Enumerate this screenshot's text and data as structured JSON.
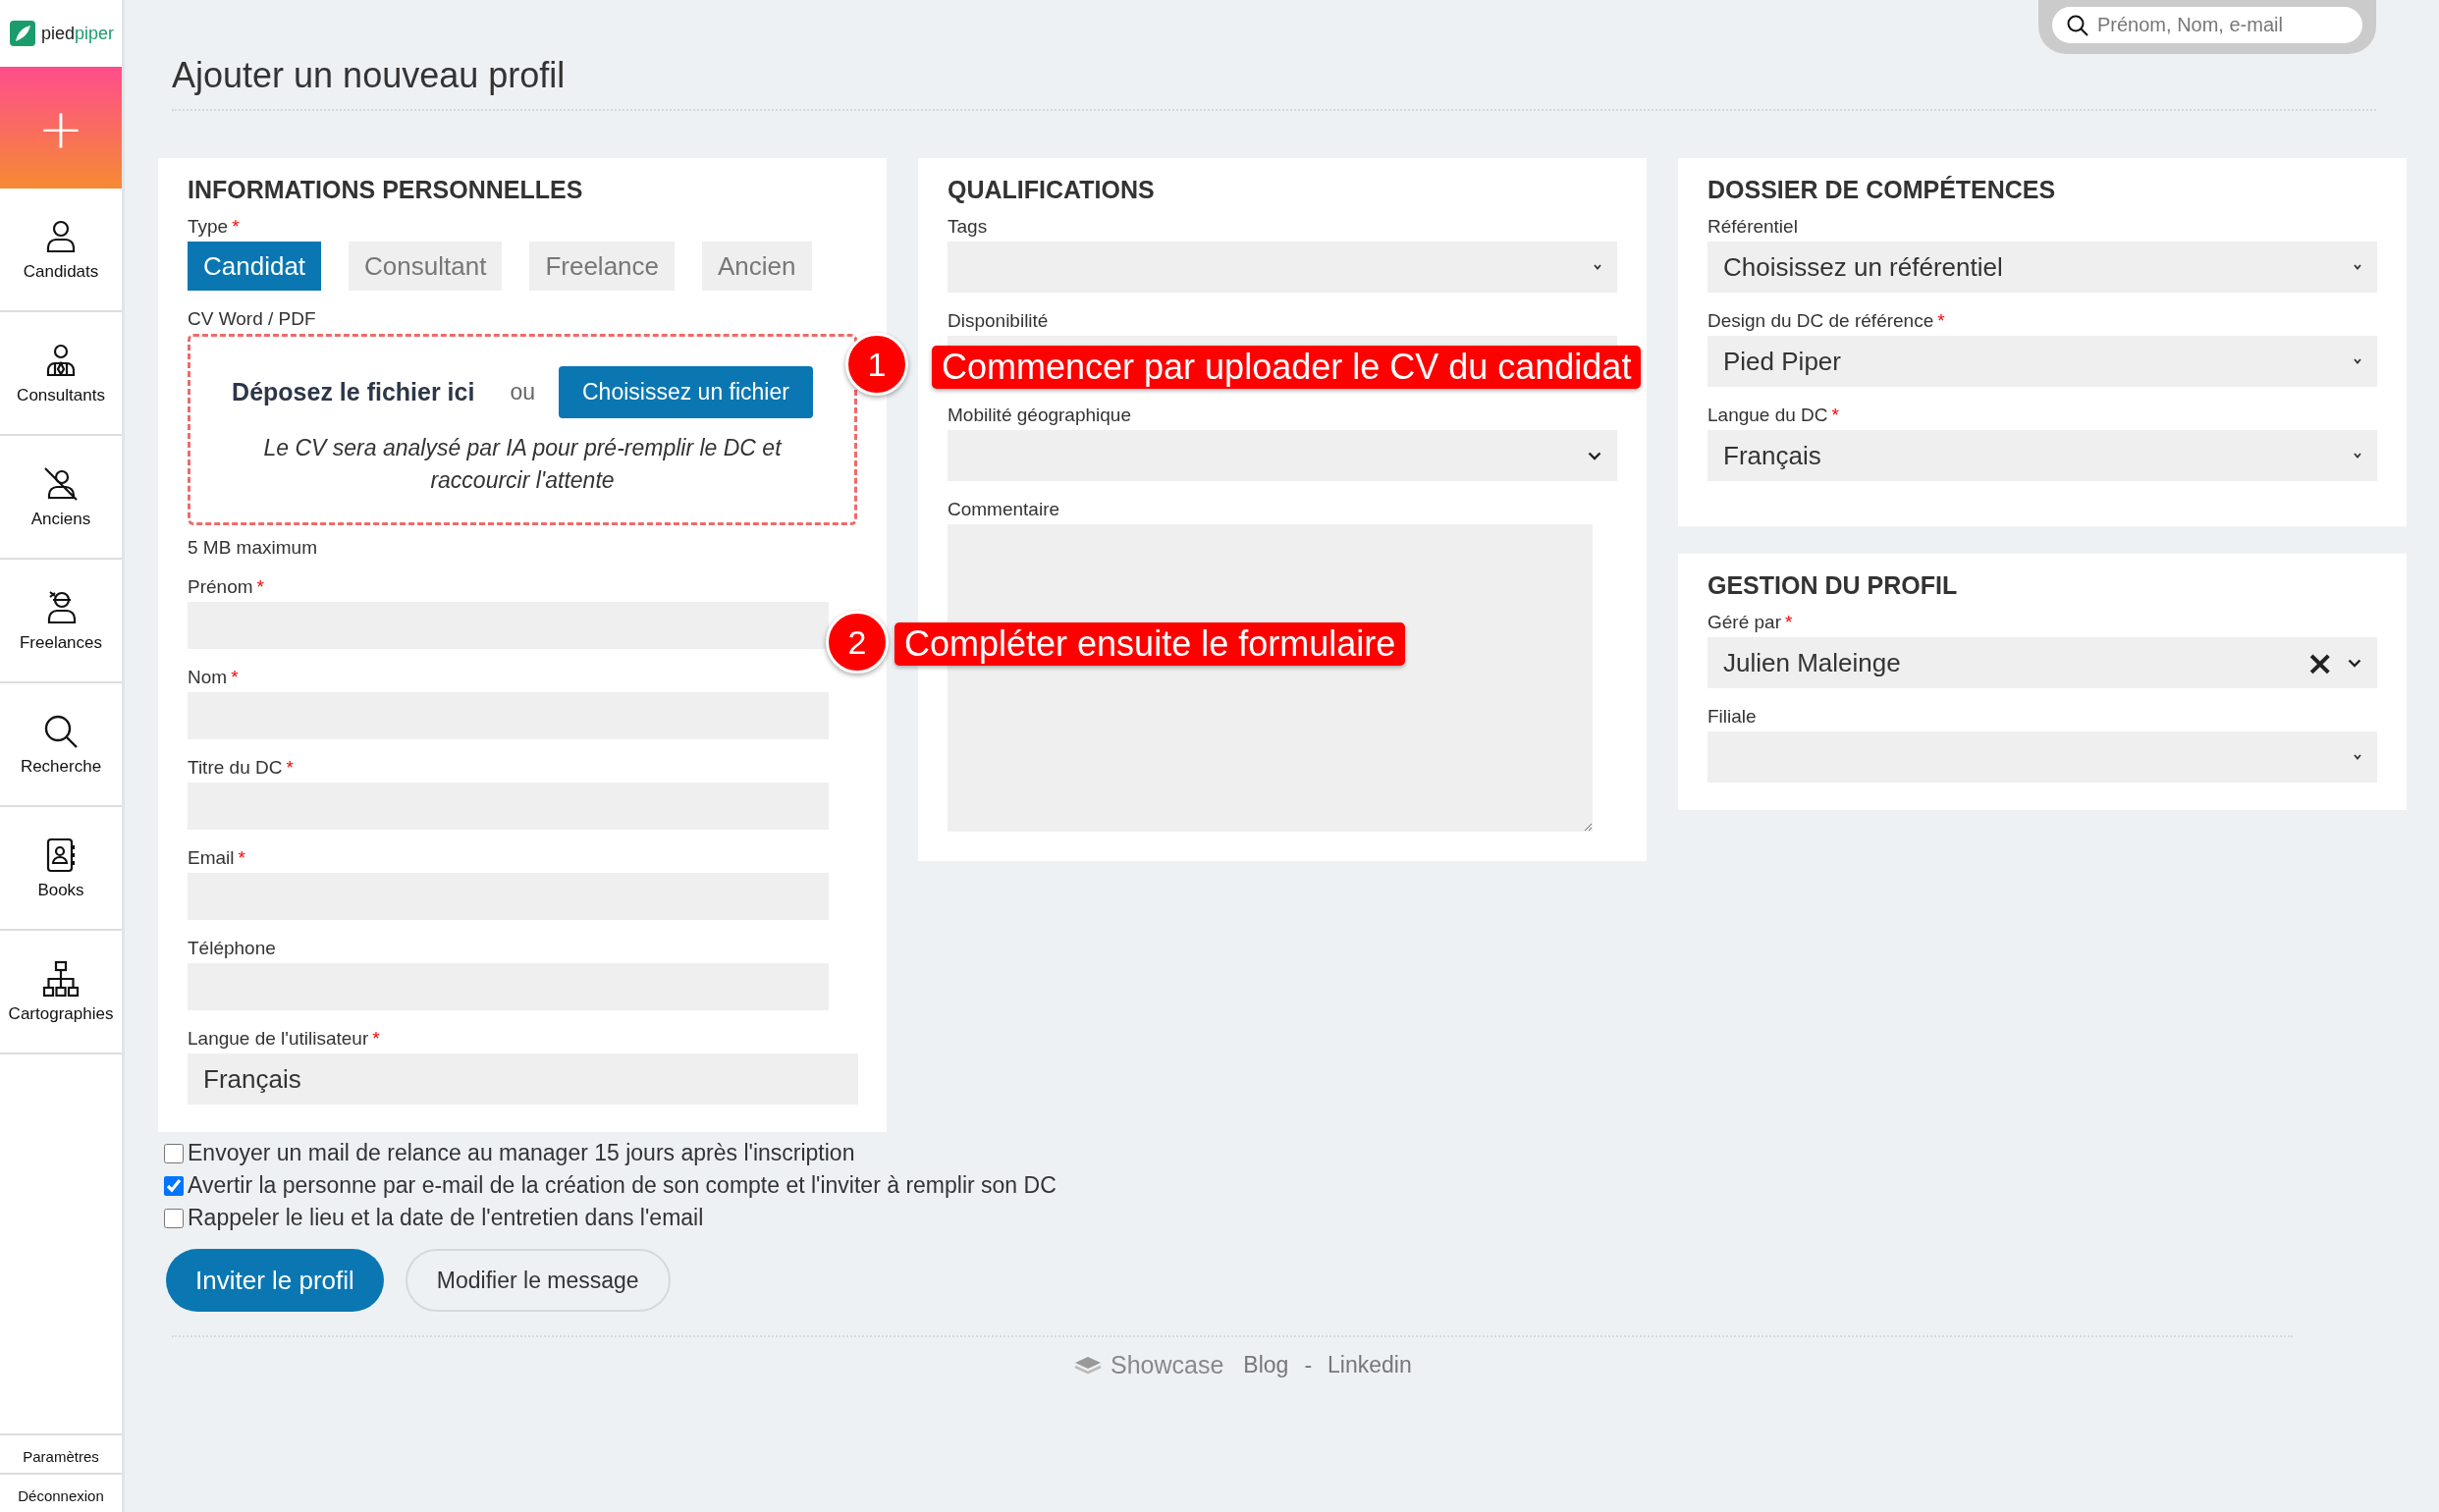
{
  "brand": {
    "part_1": "pied",
    "part_2": "piper"
  },
  "sidebar": {
    "add_button": "+",
    "items": [
      {
        "label": "Candidats",
        "kind": "person"
      },
      {
        "label": "Consultants",
        "kind": "consultant"
      },
      {
        "label": "Anciens",
        "kind": "former"
      },
      {
        "label": "Freelances",
        "kind": "freelance"
      },
      {
        "label": "Recherche",
        "kind": "search"
      },
      {
        "label": "Books",
        "kind": "book"
      },
      {
        "label": "Cartographies",
        "kind": "org"
      }
    ],
    "bottom_links": [
      "Paramètres",
      "Déconnexion"
    ]
  },
  "search": {
    "placeholder": "Prénom, Nom, e-mail"
  },
  "page_title": "Ajouter un nouveau profil",
  "columns": [
    [
      {
        "title": "INFORMATIONS PERSONNELLES",
        "fields": [
          {
            "kind": "tabs",
            "label": "Type",
            "required_mark": "*",
            "tabs": [
              {
                "label": "Candidat",
                "selected": true
              },
              {
                "label": "Consultant",
                "selected": false
              },
              {
                "label": "Freelance",
                "selected": false
              },
              {
                "label": "Ancien",
                "selected": false
              }
            ]
          },
          {
            "kind": "dropzone",
            "label": "CV Word / PDF",
            "drop_text": "Déposez le fichier ici",
            "or_text": "ou",
            "button": "Choisissez un fichier",
            "hint": "Le CV sera analysé par IA pour pré-remplir le DC et raccourcir l'attente"
          },
          {
            "kind": "note",
            "text": "5 MB maximum"
          },
          {
            "kind": "input",
            "label": "Prénom",
            "required_mark": "*"
          },
          {
            "kind": "input",
            "label": "Nom",
            "required_mark": "*"
          },
          {
            "kind": "input",
            "label": "Titre du DC",
            "required_mark": "*"
          },
          {
            "kind": "input",
            "label": "Email",
            "required_mark": "*"
          },
          {
            "kind": "input",
            "label": "Téléphone"
          },
          {
            "kind": "value_field",
            "label": "Langue de l'utilisateur",
            "required_mark": "*",
            "value": "Français"
          }
        ]
      }
    ],
    [
      {
        "title": "QUALIFICATIONS",
        "fields": [
          {
            "kind": "select",
            "label": "Tags"
          },
          {
            "kind": "plain_select",
            "label": "Disponibilité"
          },
          {
            "kind": "dropdown",
            "label": "Mobilité géographique"
          },
          {
            "kind": "textarea",
            "label": "Commentaire"
          }
        ]
      }
    ],
    [
      {
        "title": "DOSSIER DE COMPÉTENCES",
        "fields": [
          {
            "kind": "select",
            "label": "Référentiel",
            "value": "Choisissez un référentiel"
          },
          {
            "kind": "select",
            "label": "Design du DC de référence",
            "required_mark": "*",
            "value": "Pied Piper"
          },
          {
            "kind": "select",
            "label": "Langue du DC",
            "required_mark": "*",
            "value": "Français"
          }
        ]
      },
      {
        "title": "GESTION DU PROFIL",
        "fields": [
          {
            "kind": "dropdown",
            "label": "Géré par",
            "required_mark": "*",
            "value": "Julien Maleinge",
            "clear": "×"
          },
          {
            "kind": "select",
            "label": "Filiale"
          }
        ]
      }
    ]
  ],
  "options": [
    {
      "label": "Envoyer un mail de relance au manager 15 jours après l'inscription",
      "checked": false
    },
    {
      "label": "Avertir la personne par e-mail de la création de son compte et l'inviter à remplir son DC",
      "checked": true
    },
    {
      "label": "Rappeler le lieu et la date de l'entretien dans l'email",
      "checked": false
    }
  ],
  "buttons": [
    {
      "label": "Inviter le profil",
      "kind": "primary"
    },
    {
      "label": "Modifier le message",
      "kind": "secondary"
    }
  ],
  "footer": {
    "brand": "Showcase",
    "links": [
      "Blog",
      "Linkedin"
    ],
    "separator": "-"
  },
  "annotations": [
    {
      "number": "1",
      "text": "Commencer par uploader le CV du candidat"
    },
    {
      "number": "2",
      "text": "Compléter ensuite le formulaire"
    }
  ]
}
